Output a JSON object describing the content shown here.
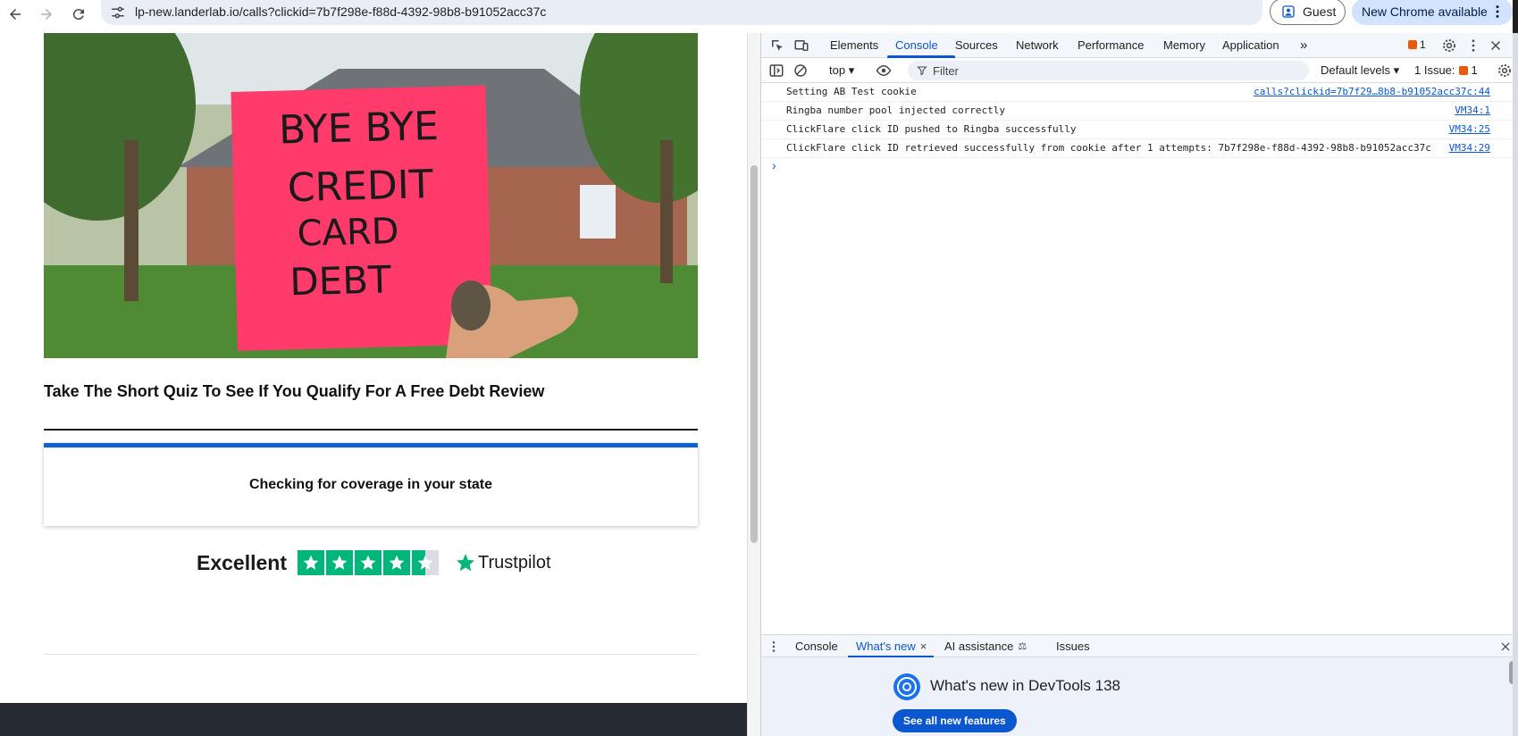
{
  "browser": {
    "url": "lp-new.landerlab.io/calls?clickid=7b7f298e-f88d-4392-98b8-b91052acc37c",
    "guest_label": "Guest",
    "update_label": "New Chrome available"
  },
  "page": {
    "hero_note_lines": [
      "BYE BYE",
      "CREDIT",
      "CARD",
      "DEBT"
    ],
    "headline": "Take The Short Quiz To See If You Qualify For A Free Debt Review",
    "quiz_status": "Checking for coverage in your state",
    "trust_rating_label": "Excellent",
    "trust_brand": "Trustpilot",
    "trust_stars": 4.5
  },
  "devtools": {
    "tabs": [
      "Elements",
      "Console",
      "Sources",
      "Network",
      "Performance",
      "Memory",
      "Application"
    ],
    "active_tab": "Console",
    "issue_badge_count": "1",
    "context": "top",
    "filter_placeholder": "Filter",
    "levels_label": "Default levels",
    "issues_label": "1 Issue:",
    "issues_count": "1",
    "logs": [
      {
        "message": "Setting AB Test cookie",
        "source": "calls?clickid=7b7f29…8b8-b91052acc37c:44"
      },
      {
        "message": "Ringba number pool injected correctly",
        "source": "VM34:1"
      },
      {
        "message": "ClickFlare click ID pushed to Ringba successfully",
        "source": "VM34:25"
      },
      {
        "message": "ClickFlare click ID retrieved successfully from cookie after 1 attempts: 7b7f298e-f88d-4392-98b8-b91052acc37c",
        "source": "VM34:29"
      }
    ],
    "drawer_tabs": [
      "Console",
      "What's new",
      "AI assistance",
      "Issues"
    ],
    "drawer_active": "What's new",
    "whats_new_title": "What's new in DevTools 138",
    "whats_new_button": "See all new features"
  },
  "colors": {
    "accent": "#0b57d0",
    "quiz_bar": "#0b63ce",
    "trustpilot_green": "#00b67a",
    "sticky_note": "#ff3b6b",
    "footer": "#262a33"
  }
}
